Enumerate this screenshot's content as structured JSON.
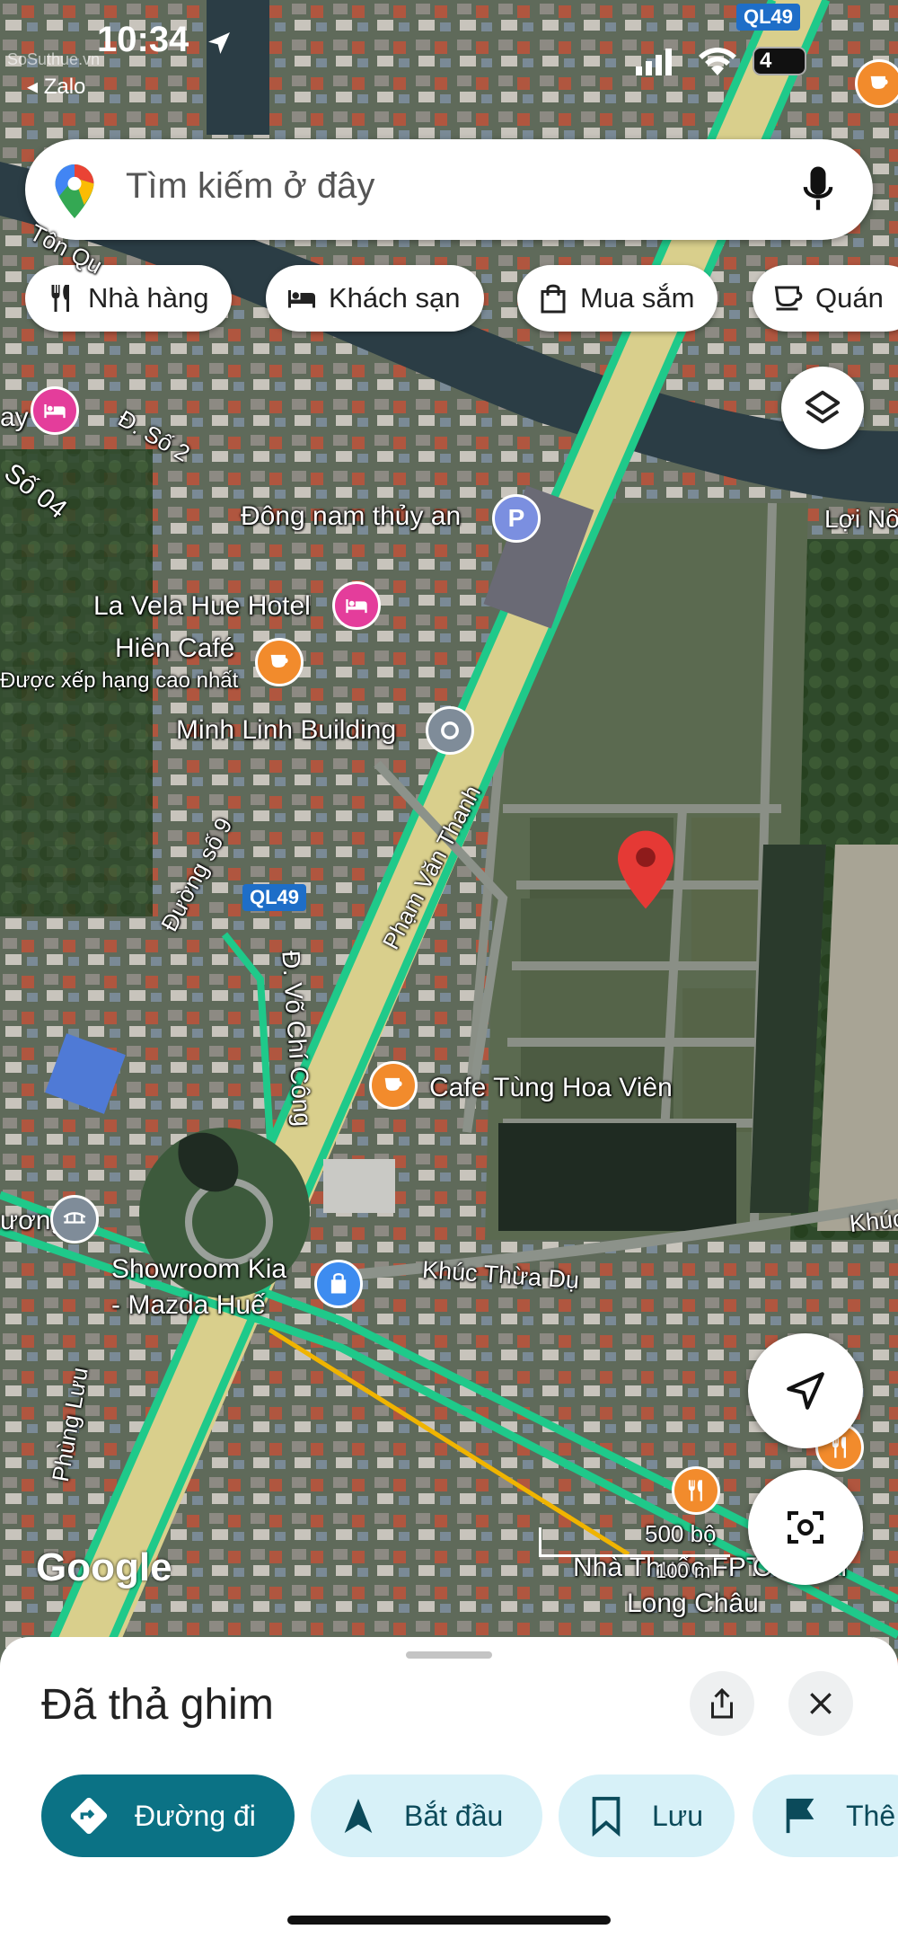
{
  "status_bar": {
    "time": "10:34",
    "back_app": "◂ Zalo",
    "battery": "4",
    "watermark": "SoSuthue.vn"
  },
  "search": {
    "placeholder": "Tìm kiếm ở đây"
  },
  "chips": [
    {
      "label": "Nhà hàng",
      "icon": "restaurant-icon"
    },
    {
      "label": "Khách sạn",
      "icon": "hotel-icon"
    },
    {
      "label": "Mua sắm",
      "icon": "shopping-bag-icon"
    },
    {
      "label": "Quán",
      "icon": "coffee-icon"
    }
  ],
  "map": {
    "road_badges": [
      "QL49",
      "QL49"
    ],
    "labels": {
      "ton_qu": "Tôn Qu",
      "d_so2": "Đ. Số 2",
      "so04": "Số 04",
      "ay": "ay",
      "dong_nam": "Đông nam thủy an",
      "loi_no": "Lợi Nô",
      "la_vela": "La Vela Hue Hotel",
      "hien_cafe": "Hiên Café",
      "hien_cafe_sub": "Được xếp hạng cao nhất",
      "minh_linh": "Minh Linh Building",
      "duong_so9": "Đường số 9",
      "pham_van_thanh": "Phạm Văn Thanh",
      "vo_chi_cong": "Đ. Võ Chí Công",
      "cafe_tung": "Cafe Tùng Hoa Viên",
      "uong": "ương",
      "showroom1": "Showroom Kia",
      "showroom2": "- Mazda Huế",
      "khuc_thua_du": "Khúc Thừa Dụ",
      "khuc": "Khúc",
      "phung_luu": "Phùng Lưu",
      "nha_thuoc": "Nhà Thuốc FPT",
      "long_chau": "Long Châu",
      "ch_em": "Ch...em",
      "scale_ft": "500 bộ",
      "scale_m": "100 m",
      "google": "Google"
    }
  },
  "sheet": {
    "title": "Đã thả ghim",
    "actions": [
      {
        "label": "Đường đi",
        "icon": "directions-icon"
      },
      {
        "label": "Bắt đầu",
        "icon": "navigation-arrow-icon"
      },
      {
        "label": "Lưu",
        "icon": "bookmark-icon"
      },
      {
        "label": "Thê",
        "icon": "flag-icon"
      }
    ]
  },
  "colors": {
    "primary": "#0b7285",
    "chip_bg": "#ffffff",
    "pin": "#e53935",
    "light_button": "#d7f1f8",
    "road_green": "#1fc98a"
  }
}
